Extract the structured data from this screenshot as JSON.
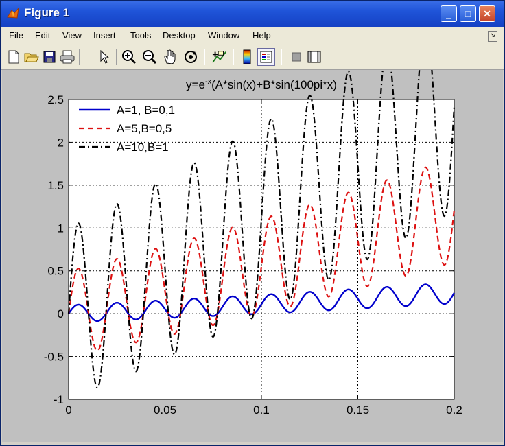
{
  "window": {
    "title": "Figure 1",
    "controls": {
      "minimize": "_",
      "maximize": "□",
      "close": "✕"
    }
  },
  "menu": {
    "items": [
      "File",
      "Edit",
      "View",
      "Insert",
      "Tools",
      "Desktop",
      "Window",
      "Help"
    ]
  },
  "toolbar": {
    "icons": [
      "new-figure-icon",
      "open-file-icon",
      "save-icon",
      "print-icon",
      "edit-plot-arrow-icon",
      "zoom-in-icon",
      "zoom-out-icon",
      "pan-hand-icon",
      "rotate-3d-icon",
      "data-cursor-icon",
      "colorbar-icon",
      "legend-icon",
      "hide-plot-tools-icon",
      "show-plot-tools-icon"
    ]
  },
  "chart_data": {
    "type": "line",
    "title_base": "y=e",
    "title_sup": "-x",
    "title_rest": "(A*sin(x)+B*sin(100pi*x)",
    "xlim": [
      0,
      0.2
    ],
    "ylim": [
      -1,
      2.5
    ],
    "xticks": [
      0,
      0.05,
      0.1,
      0.15,
      0.2
    ],
    "xtick_labels": [
      "0",
      "0.05",
      "0.1",
      "0.15",
      "0.2"
    ],
    "yticks": [
      -1,
      -0.5,
      0,
      0.5,
      1,
      1.5,
      2,
      2.5
    ],
    "ytick_labels": [
      "-1",
      "-0.5",
      "0",
      "0.5",
      "1",
      "1.5",
      "2",
      "2.5"
    ],
    "grid": true,
    "legend_position": "top-left",
    "series": [
      {
        "name": "A=1, B=0,1",
        "A": 1,
        "B": 0.1,
        "color": "#0000cc",
        "style": "solid"
      },
      {
        "name": "A=5,B=0,5",
        "A": 5,
        "B": 0.5,
        "color": "#dd1111",
        "style": "dashed"
      },
      {
        "name": "A=10,B=1",
        "A": 10,
        "B": 1,
        "color": "#000000",
        "style": "dashdot"
      }
    ]
  }
}
